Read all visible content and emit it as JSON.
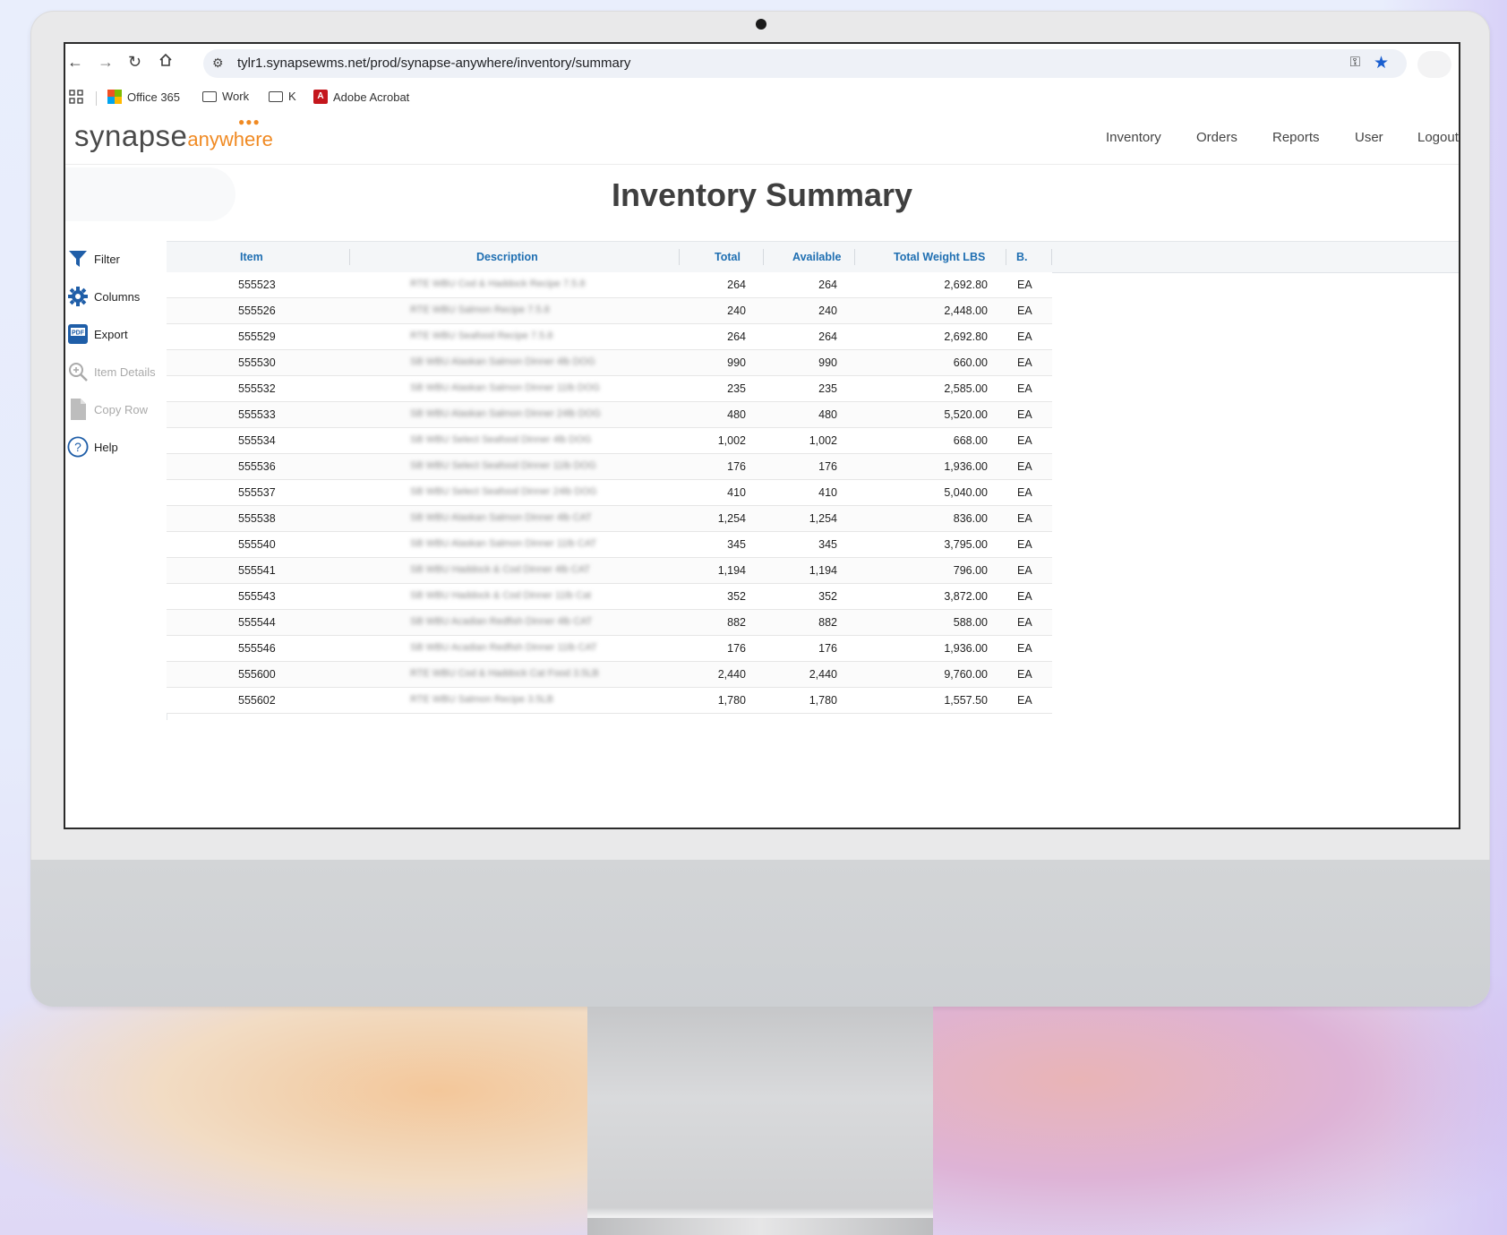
{
  "browser": {
    "url": "tylr1.synapsewms.net/prod/synapse-anywhere/inventory/summary",
    "bookmarks": [
      {
        "label": "Office 365"
      },
      {
        "label": "Work"
      },
      {
        "label": "K"
      },
      {
        "label": "Adobe Acrobat"
      }
    ]
  },
  "app": {
    "logo_main": "synapse",
    "logo_sub": "anywhere",
    "nav": [
      "Inventory",
      "Orders",
      "Reports",
      "User",
      "Logout"
    ],
    "page_title": "Inventory Summary"
  },
  "sidebar": {
    "items": [
      {
        "label": "Filter",
        "enabled": true
      },
      {
        "label": "Columns",
        "enabled": true
      },
      {
        "label": "Export",
        "enabled": true
      },
      {
        "label": "Item Details",
        "enabled": false
      },
      {
        "label": "Copy Row",
        "enabled": false
      },
      {
        "label": "Help",
        "enabled": true
      }
    ]
  },
  "table": {
    "columns": [
      "Item",
      "Description",
      "Total",
      "Available",
      "Total Weight LBS",
      "B."
    ],
    "rows": [
      {
        "item": "555523",
        "desc": "RTE WBU Cod & Haddock Recipe 7.5.8",
        "total": "264",
        "available": "264",
        "weight": "2,692.80",
        "uom": "EA"
      },
      {
        "item": "555526",
        "desc": "RTE WBU Salmon Recipe 7.5.8",
        "total": "240",
        "available": "240",
        "weight": "2,448.00",
        "uom": "EA"
      },
      {
        "item": "555529",
        "desc": "RTE WBU Seafood Recipe 7.5.8",
        "total": "264",
        "available": "264",
        "weight": "2,692.80",
        "uom": "EA"
      },
      {
        "item": "555530",
        "desc": "SB WBU Alaskan Salmon Dinner 4lb DOG",
        "total": "990",
        "available": "990",
        "weight": "660.00",
        "uom": "EA"
      },
      {
        "item": "555532",
        "desc": "SB WBU Alaskan Salmon Dinner 11lb DOG",
        "total": "235",
        "available": "235",
        "weight": "2,585.00",
        "uom": "EA"
      },
      {
        "item": "555533",
        "desc": "SB WBU Alaskan Salmon Dinner 24lb DOG",
        "total": "480",
        "available": "480",
        "weight": "5,520.00",
        "uom": "EA"
      },
      {
        "item": "555534",
        "desc": "SB WBU Select Seafood Dinner 4lb DOG",
        "total": "1,002",
        "available": "1,002",
        "weight": "668.00",
        "uom": "EA"
      },
      {
        "item": "555536",
        "desc": "SB WBU Select Seafood Dinner 11lb DOG",
        "total": "176",
        "available": "176",
        "weight": "1,936.00",
        "uom": "EA"
      },
      {
        "item": "555537",
        "desc": "SB WBU Select Seafood Dinner 24lb DOG",
        "total": "410",
        "available": "410",
        "weight": "5,040.00",
        "uom": "EA"
      },
      {
        "item": "555538",
        "desc": "SB WBU Alaskan Salmon Dinner 4lb CAT",
        "total": "1,254",
        "available": "1,254",
        "weight": "836.00",
        "uom": "EA"
      },
      {
        "item": "555540",
        "desc": "SB WBU Alaskan Salmon Dinner 11lb CAT",
        "total": "345",
        "available": "345",
        "weight": "3,795.00",
        "uom": "EA"
      },
      {
        "item": "555541",
        "desc": "SB WBU Haddock & Cod Dinner 4lb CAT",
        "total": "1,194",
        "available": "1,194",
        "weight": "796.00",
        "uom": "EA"
      },
      {
        "item": "555543",
        "desc": "SB WBU Haddock & Cod Dinner 11lb Cat",
        "total": "352",
        "available": "352",
        "weight": "3,872.00",
        "uom": "EA"
      },
      {
        "item": "555544",
        "desc": "SB WBU Acadian Redfish Dinner 4lb CAT",
        "total": "882",
        "available": "882",
        "weight": "588.00",
        "uom": "EA"
      },
      {
        "item": "555546",
        "desc": "SB WBU Acadian Redfish Dinner 11lb CAT",
        "total": "176",
        "available": "176",
        "weight": "1,936.00",
        "uom": "EA"
      },
      {
        "item": "555600",
        "desc": "RTE WBU Cod & Haddock Cat Food 3.5LB",
        "total": "2,440",
        "available": "2,440",
        "weight": "9,760.00",
        "uom": "EA"
      },
      {
        "item": "555602",
        "desc": "RTE WBU Salmon Recipe 3.5LB",
        "total": "1,780",
        "available": "1,780",
        "weight": "1,557.50",
        "uom": "EA"
      }
    ]
  },
  "colors": {
    "accent": "#1f6fb2",
    "logo_orange": "#f08a23",
    "acrobat_red": "#c4161c"
  }
}
